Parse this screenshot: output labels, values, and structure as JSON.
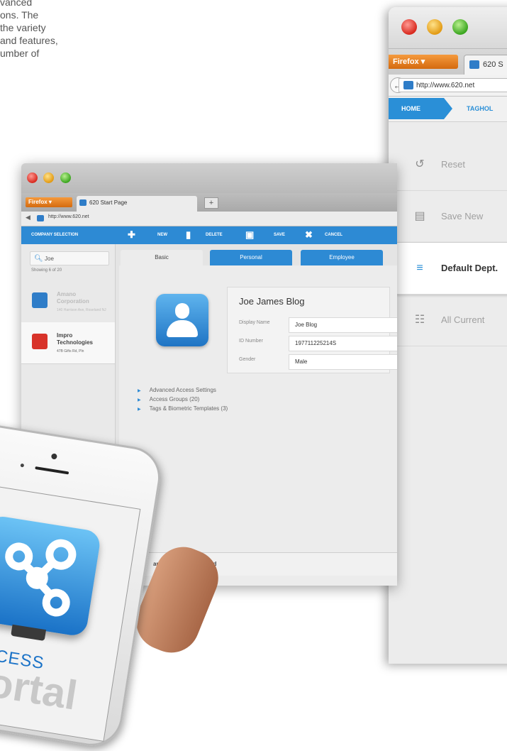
{
  "intro": {
    "text": "vanced\nons. The\nthe variety\nand features,\number of"
  },
  "right_window": {
    "firefox_label": "Firefox",
    "tab_title": "620 S",
    "url": "http://www.620.net",
    "nav": {
      "home": "HOME",
      "tag": "TAGHOL"
    },
    "items": [
      {
        "label": "Reset",
        "icon": "undo-icon",
        "glyph": "↺",
        "selected": false
      },
      {
        "label": "Save New",
        "icon": "floppy-icon",
        "glyph": "▤",
        "selected": false
      },
      {
        "label": "Default Dept.",
        "icon": "layers-icon",
        "glyph": "≡",
        "selected": true
      },
      {
        "label": "All Current",
        "icon": "grid-icon",
        "glyph": "☷",
        "selected": false
      }
    ]
  },
  "left_window": {
    "firefox_label": "Firefox",
    "tab_title": "620 Start Page",
    "new_tab": "+",
    "url": "http://www.620.net",
    "toolbar": {
      "company_selection": "COMPANY SELECTION",
      "new": "NEW",
      "delete": "DELETE",
      "save": "SAVE",
      "cancel": "CANCEL"
    },
    "search_value": "Joe",
    "showing": "Showing 6 of 20",
    "companies": [
      {
        "name": "Amano Corporation",
        "address": "140 Harrison Ave, Roseland NJ",
        "active": false,
        "color": "#2f7dc8"
      },
      {
        "name": "Impro Technologies",
        "address": "47B Gifts Rd, Pln",
        "active": true,
        "color": "#d8332a"
      }
    ],
    "tabs": [
      "Basic",
      "Personal",
      "Employee"
    ],
    "person": {
      "name": "Joe James Blog",
      "fields": [
        {
          "label": "Display Name",
          "value": "Joe Blog"
        },
        {
          "label": "ID Number",
          "value": "197711225214S"
        },
        {
          "label": "Gender",
          "value": "Male"
        }
      ]
    },
    "links": [
      "Advanced Access Settings",
      "Access Groups (20)",
      "Tags & Biometric Templates (3)"
    ],
    "status": "anges have been saved"
  },
  "phone": {
    "app_word1": "ACCESS",
    "app_word2": "portal"
  },
  "colors": {
    "accent": "#2a8fd7",
    "firefox_orange": "#e67c1f"
  }
}
